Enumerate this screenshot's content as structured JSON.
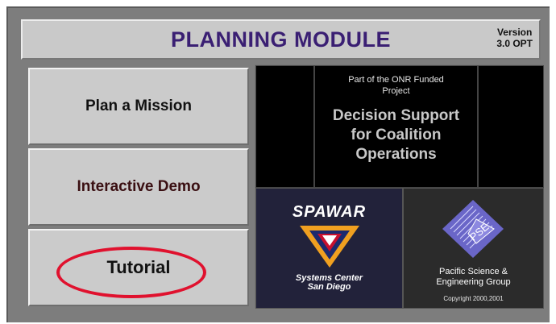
{
  "header": {
    "title": "PLANNING MODULE",
    "version_line1": "Version",
    "version_line2": "3.0 OPT"
  },
  "menu": {
    "plan_label": "Plan a Mission",
    "demo_label": "Interactive Demo",
    "tutorial_label": "Tutorial"
  },
  "info": {
    "onr_line1": "Part of the ONR Funded",
    "onr_line2": "Project",
    "project_line1": "Decision Support",
    "project_line2": "for Coalition",
    "project_line3": "Operations"
  },
  "spawar": {
    "logo_text": "SPAWAR",
    "sub_line1": "Systems Center",
    "sub_line2": "San Diego",
    "icon": "spawar-chevron-icon"
  },
  "pse": {
    "logo_text": "PSE",
    "name_line1": "Pacific Science &",
    "name_line2": "Engineering Group",
    "copyright": "Copyright 2000,2001",
    "icon": "pse-diamond-icon"
  },
  "colors": {
    "title": "#3a1f73",
    "highlight_ellipse": "#e0112e",
    "demo_label": "#3a0f12"
  }
}
